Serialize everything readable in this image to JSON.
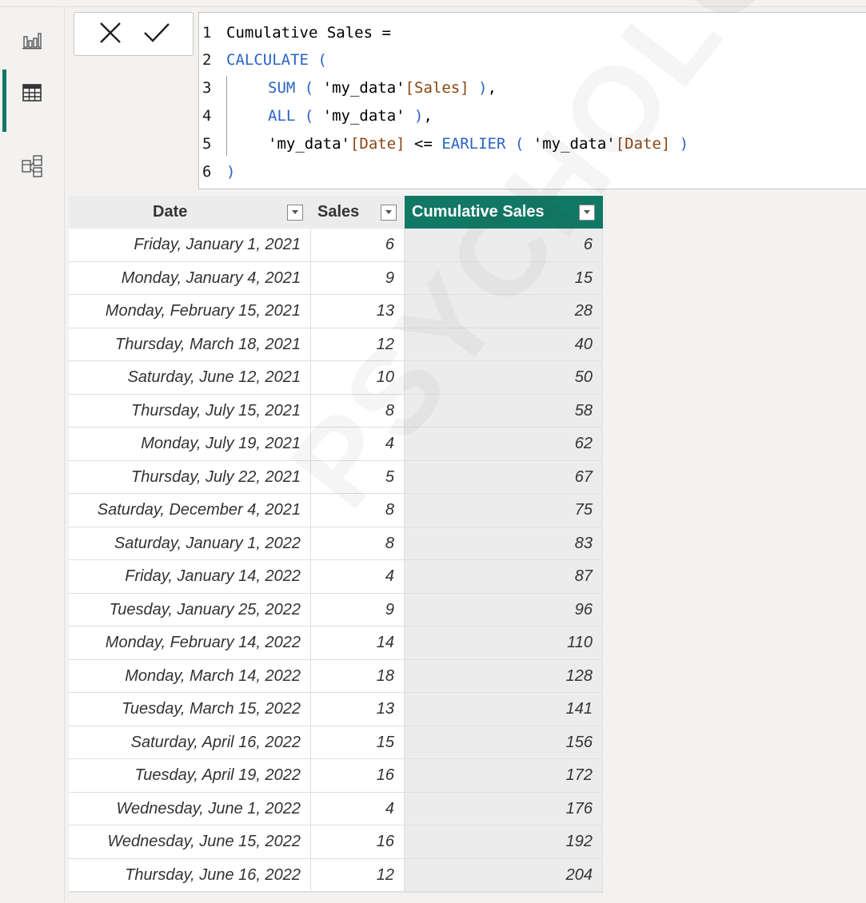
{
  "formula_bar": {
    "lines": [
      {
        "num": "1",
        "text": "Cumulative Sales ="
      },
      {
        "num": "2",
        "text": "CALCULATE ("
      },
      {
        "num": "3",
        "text": "SUM ( 'my_data'[Sales] ),"
      },
      {
        "num": "4",
        "text": "ALL ( 'my_data' ),"
      },
      {
        "num": "5",
        "text": "'my_data'[Date] <= EARLIER ( 'my_data'[Date] )"
      },
      {
        "num": "6",
        "text": ")"
      }
    ]
  },
  "table": {
    "columns": [
      "Date",
      "Sales",
      "Cumulative Sales"
    ],
    "rows": [
      [
        "Friday, January 1, 2021",
        "6",
        "6"
      ],
      [
        "Monday, January 4, 2021",
        "9",
        "15"
      ],
      [
        "Monday, February 15, 2021",
        "13",
        "28"
      ],
      [
        "Thursday, March 18, 2021",
        "12",
        "40"
      ],
      [
        "Saturday, June 12, 2021",
        "10",
        "50"
      ],
      [
        "Thursday, July 15, 2021",
        "8",
        "58"
      ],
      [
        "Monday, July 19, 2021",
        "4",
        "62"
      ],
      [
        "Thursday, July 22, 2021",
        "5",
        "67"
      ],
      [
        "Saturday, December 4, 2021",
        "8",
        "75"
      ],
      [
        "Saturday, January 1, 2022",
        "8",
        "83"
      ],
      [
        "Friday, January 14, 2022",
        "4",
        "87"
      ],
      [
        "Tuesday, January 25, 2022",
        "9",
        "96"
      ],
      [
        "Monday, February 14, 2022",
        "14",
        "110"
      ],
      [
        "Monday, March 14, 2022",
        "18",
        "128"
      ],
      [
        "Tuesday, March 15, 2022",
        "13",
        "141"
      ],
      [
        "Saturday, April 16, 2022",
        "15",
        "156"
      ],
      [
        "Tuesday, April 19, 2022",
        "16",
        "172"
      ],
      [
        "Wednesday, June 1, 2022",
        "4",
        "176"
      ],
      [
        "Wednesday, June 15, 2022",
        "16",
        "192"
      ],
      [
        "Thursday, June 16, 2022",
        "12",
        "204"
      ]
    ]
  },
  "watermark": "PSYCHOLOGY.CO",
  "colors": {
    "accent": "#117865",
    "keyword": "#2a64c5",
    "column_ref": "#8b4513"
  },
  "icons": {
    "rail": [
      "report-view-icon",
      "table-view-icon",
      "model-view-icon"
    ],
    "formula": [
      "cancel-icon",
      "commit-icon"
    ]
  }
}
